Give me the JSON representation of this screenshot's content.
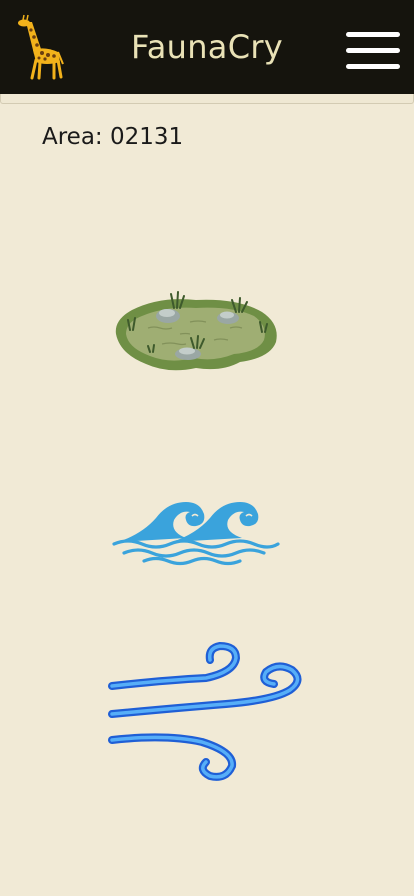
{
  "app": {
    "title": "FaunaCry"
  },
  "area": {
    "label": "Area: 02131"
  },
  "icons": {
    "logo": "giraffe-icon",
    "menu": "hamburger-menu-icon",
    "tiles": [
      "grassland-icon",
      "water-waves-icon",
      "wind-icon"
    ]
  },
  "colors": {
    "header_bg": "#15140d",
    "page_bg": "#f1ead6",
    "title": "#e9e2b6",
    "land": "#6f8f45",
    "water": "#3aa3dc",
    "air": "#2e7ff0"
  }
}
